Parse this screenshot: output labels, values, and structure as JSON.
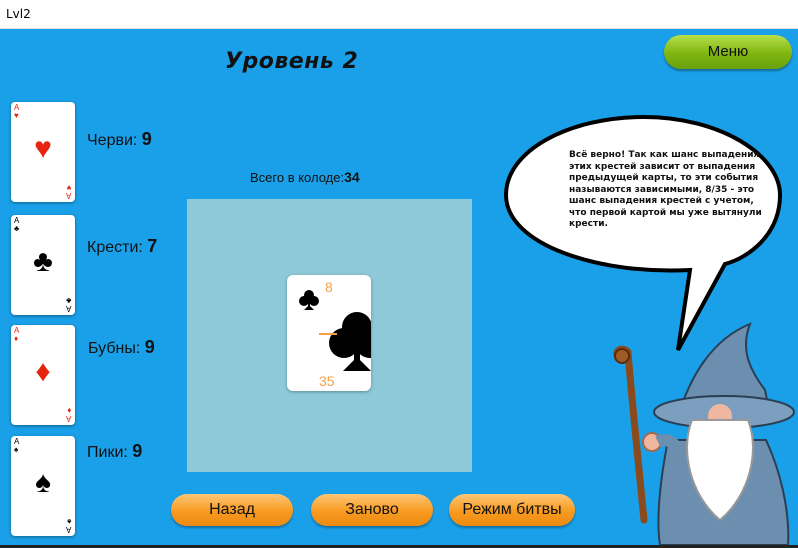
{
  "window": {
    "title": "Lvl2"
  },
  "level_title": "Уровень 2",
  "menu_label": "Меню",
  "suits": [
    {
      "name": "Черви:",
      "count": "9",
      "symbol": "♥",
      "rank": "A",
      "color": "#e52510"
    },
    {
      "name": "Крести:",
      "count": "7",
      "symbol": "♣",
      "rank": "A",
      "color": "#000000"
    },
    {
      "name": "Бубны:",
      "count": "9",
      "symbol": "♦",
      "rank": "A",
      "color": "#e52510"
    },
    {
      "name": "Пики:",
      "count": "9",
      "symbol": "♠",
      "rank": "A",
      "color": "#000000"
    }
  ],
  "deck": {
    "label": "Всего в колоде:",
    "count": "34"
  },
  "drawn_card": {
    "numerator": "8",
    "denominator": "35",
    "suit_icon": "club-icon"
  },
  "speech": "Всё верно! Так как шанс выпадения этих крестей зависит от выпадения предыдущей карты, то эти события называются зависимыми, 8/35 - это шанс выпадения крестей с учетом, что первой картой мы уже вытянули крести.",
  "buttons": {
    "back": "Назад",
    "restart": "Заново",
    "battle": "Режим битвы"
  },
  "colors": {
    "background": "#1aa0e8",
    "table": "#8dc9d8",
    "menu_button": "#8fc221",
    "action_button": "#f79a1f"
  }
}
